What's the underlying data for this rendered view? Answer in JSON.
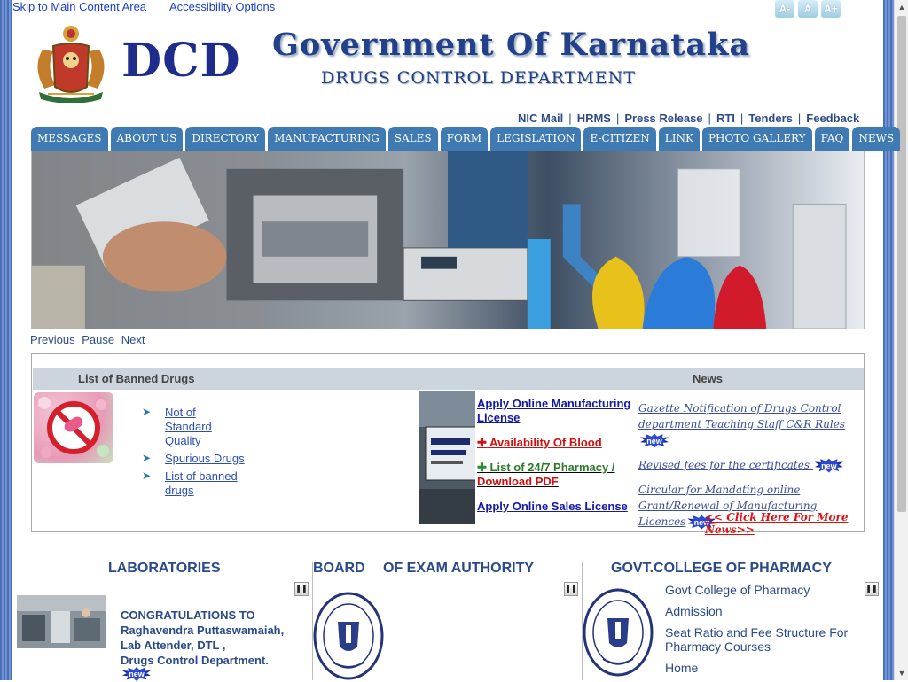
{
  "header": {
    "skip_link": "Skip to Main Content Area",
    "accessibility_link": "Accessibility Options",
    "font_buttons": [
      "A-",
      "A",
      "A+"
    ],
    "logo_text": "DCD",
    "gov_title": "Government Of Karnataka",
    "dept_title": "DRUGS CONTROL DEPARTMENT"
  },
  "top_links": [
    "NIC Mail",
    "HRMS",
    "Press Release",
    "RTI",
    "Tenders",
    "Feedback"
  ],
  "nav": [
    "MESSAGES",
    "ABOUT US",
    "DIRECTORY",
    "MANUFACTURING",
    "SALES",
    "FORM",
    "LEGISLATION",
    "E-CITIZEN",
    "LINK",
    "PHOTO GALLERY",
    "FAQ",
    "NEWS"
  ],
  "slideshow": {
    "previous": "Previous",
    "pause": "Pause",
    "next": "Next"
  },
  "banned": {
    "header": "List of Banned Drugs",
    "items": [
      "Not of Standard Quality",
      "Spurious Drugs",
      "List of banned drugs"
    ]
  },
  "quick_links": {
    "manufacturing": "Apply Online Manufacturing License",
    "blood": "Availability Of Blood",
    "pharmacy_prefix": "List of 24/7 Pharmacy /",
    "pharmacy_pdf": "Download PDF",
    "sales": "Apply Online Sales License"
  },
  "news": {
    "header": "News",
    "items": [
      "Gazette Notification of Drugs Control department Teaching Staff C&R Rules",
      "Revised fees for the certificates",
      "Circular for Mandating online Grant/Renewal of Manufacturing Licences"
    ],
    "badge": "new",
    "more": "<< Click Here For More News>>"
  },
  "laboratories": {
    "title": "LABORATORIES",
    "text": [
      "CONGRATULATIONS TO",
      "Raghavendra Puttaswamaiah,",
      "Lab Attender, DTL ,",
      "Drugs Control Department."
    ]
  },
  "board": {
    "title_a": "BOARD",
    "title_b": "OF EXAM AUTHORITY"
  },
  "college": {
    "title": "GOVT.COLLEGE OF PHARMACY",
    "links": [
      "Govt College of Pharmacy",
      "Admission",
      "Seat Ratio and Fee Structure For Pharmacy Courses",
      "Home"
    ]
  },
  "colors": {
    "nav_bg": "#3f7ab2",
    "link_blue": "#2d4b8b",
    "accent_red": "#d01010",
    "header_blue": "#23408a"
  }
}
